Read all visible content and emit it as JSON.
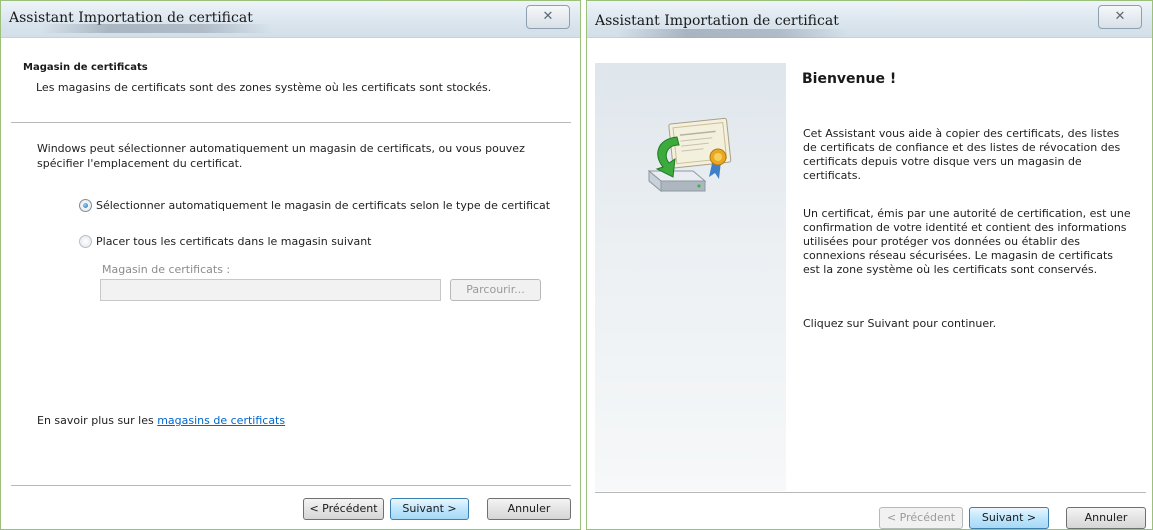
{
  "left_window": {
    "title": "Assistant Importation de certificat",
    "close_glyph": "✕",
    "header_title": "Magasin de certificats",
    "header_description": "Les magasins de certificats sont des zones système où les certificats sont stockés.",
    "intro_text": "Windows peut sélectionner automatiquement un magasin de certificats, ou vous pouvez spécifier l'emplacement du certificat.",
    "radio_auto_label": "Sélectionner automatiquement le magasin de certificats selon le type de certificat",
    "radio_auto_checked": true,
    "radio_manual_label": "Placer tous les certificats dans le magasin suivant",
    "radio_manual_checked": false,
    "store_field_label": "Magasin de certificats :",
    "store_field_value": "",
    "browse_label": "Parcourir...",
    "learn_more_prefix": "En savoir plus sur les ",
    "learn_more_link": "magasins de certificats",
    "back_label": "< Précédent",
    "next_label": "Suivant >",
    "cancel_label": "Annuler"
  },
  "right_window": {
    "title": "Assistant Importation de certificat",
    "close_glyph": "✕",
    "welcome_title": "Bienvenue !",
    "para1": "Cet Assistant vous aide à copier des certificats, des listes de certificats de confiance et des listes de révocation des certificats depuis votre disque vers un magasin de certificats.",
    "para2": "Un certificat, émis par une autorité de certification, est une confirmation de votre identité et contient des informations utilisées pour protéger vos données ou établir des connexions réseau sécurisées. Le magasin de certificats est la zone système où les certificats sont conservés.",
    "para3": "Cliquez sur Suivant pour continuer.",
    "back_label": "< Précédent",
    "next_label": "Suivant >",
    "cancel_label": "Annuler"
  },
  "icons": {
    "wizard": "certificate-import-icon",
    "close": "close-icon"
  },
  "colors": {
    "link": "#0066cc",
    "window_border": "#9cbf7c",
    "default_button": "#bee6fd"
  }
}
